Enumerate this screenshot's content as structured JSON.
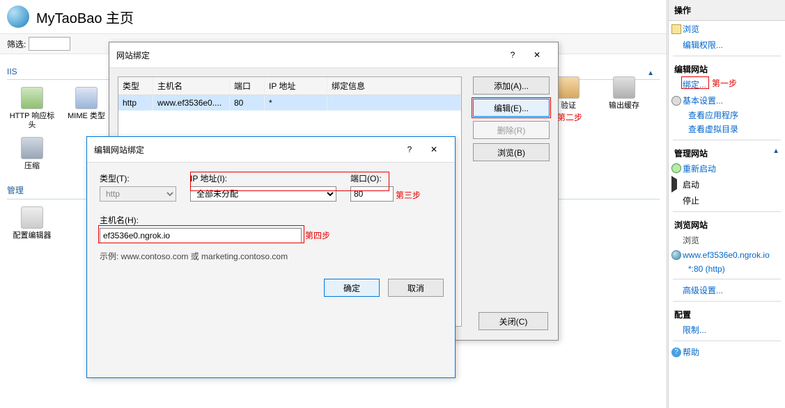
{
  "header": {
    "title": "MyTaoBao 主页"
  },
  "filter": {
    "label": "筛选:"
  },
  "groups": {
    "iis": {
      "title": "IIS",
      "features": [
        {
          "label": "HTTP 响应标头"
        },
        {
          "label": "MIME 类型"
        },
        {
          "label": "验证"
        },
        {
          "label": "输出缓存"
        },
        {
          "label": "压缩"
        }
      ]
    },
    "management": {
      "title": "管理",
      "features": [
        {
          "label": "配置编辑器"
        }
      ]
    }
  },
  "bindings_dialog": {
    "title": "网站绑定",
    "columns": {
      "type": "类型",
      "host": "主机名",
      "port": "端口",
      "ip": "IP 地址",
      "info": "绑定信息"
    },
    "rows": [
      {
        "type": "http",
        "host": "www.ef3536e0....",
        "port": "80",
        "ip": "*",
        "info": ""
      }
    ],
    "buttons": {
      "add": "添加(A)...",
      "edit": "编辑(E)...",
      "remove": "删除(R)",
      "browse": "浏览(B)",
      "close": "关闭(C)"
    }
  },
  "edit_dialog": {
    "title": "编辑网站绑定",
    "labels": {
      "type": "类型(T):",
      "ip": "IP 地址(I):",
      "port": "端口(O):",
      "host": "主机名(H):"
    },
    "values": {
      "type": "http",
      "ip": "全部未分配",
      "port": "80",
      "host": "ef3536e0.ngrok.io"
    },
    "example": "示例: www.contoso.com 或 marketing.contoso.com",
    "ok": "确定",
    "cancel": "取消"
  },
  "actions": {
    "title": "操作",
    "browse": "浏览",
    "edit_permissions": "编辑权限...",
    "edit_site_header": "编辑网站",
    "bindings": "绑定...",
    "basic_settings": "基本设置...",
    "view_apps": "查看应用程序",
    "view_vdirs": "查看虚拟目录",
    "manage_site_header": "管理网站",
    "restart": "重新启动",
    "start": "启动",
    "stop": "停止",
    "browse_site_header": "浏览网站",
    "browse_item": "浏览",
    "site_url": "www.ef3536e0.ngrok.io",
    "site_binding_text": "*:80 (http)",
    "advanced": "高级设置...",
    "config_header": "配置",
    "limits": "限制...",
    "help": "帮助"
  },
  "annotations": {
    "step1": "第一步",
    "step2": "第二步",
    "step3": "第三步",
    "step4": "第四步"
  }
}
